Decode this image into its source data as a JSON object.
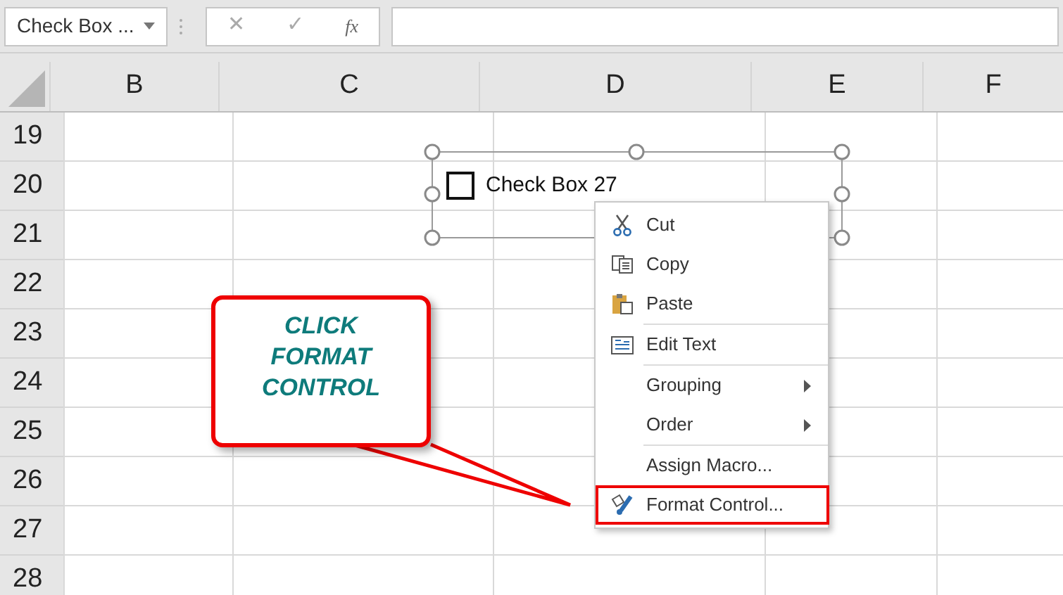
{
  "name_box": {
    "value": "Check Box ..."
  },
  "formula_bar": {
    "cancel": "✕",
    "enter": "✓",
    "function": "fx"
  },
  "columns": [
    "B",
    "C",
    "D",
    "E",
    "F"
  ],
  "rows": [
    "19",
    "20",
    "21",
    "22",
    "23",
    "24",
    "25",
    "26",
    "27",
    "28"
  ],
  "checkbox": {
    "label": "Check Box 27",
    "checked": false,
    "selected": true
  },
  "context_menu": {
    "sections": [
      [
        {
          "label": "Cut",
          "kind": "item",
          "highlighted": false
        },
        {
          "label": "Copy",
          "kind": "item",
          "highlighted": false
        },
        {
          "label": "Paste",
          "kind": "item",
          "highlighted": false
        }
      ],
      [
        {
          "label": "Edit Text",
          "kind": "item",
          "highlighted": false
        }
      ],
      [
        {
          "label": "Grouping",
          "kind": "submenu",
          "highlighted": false
        },
        {
          "label": "Order",
          "kind": "submenu",
          "highlighted": false
        }
      ],
      [
        {
          "label": "Assign Macro...",
          "kind": "item",
          "highlighted": false
        },
        {
          "label": "Format Control...",
          "kind": "item",
          "highlighted": true
        }
      ]
    ]
  },
  "callout": {
    "lines": [
      "CLICK",
      "FORMAT",
      "CONTROL"
    ]
  }
}
